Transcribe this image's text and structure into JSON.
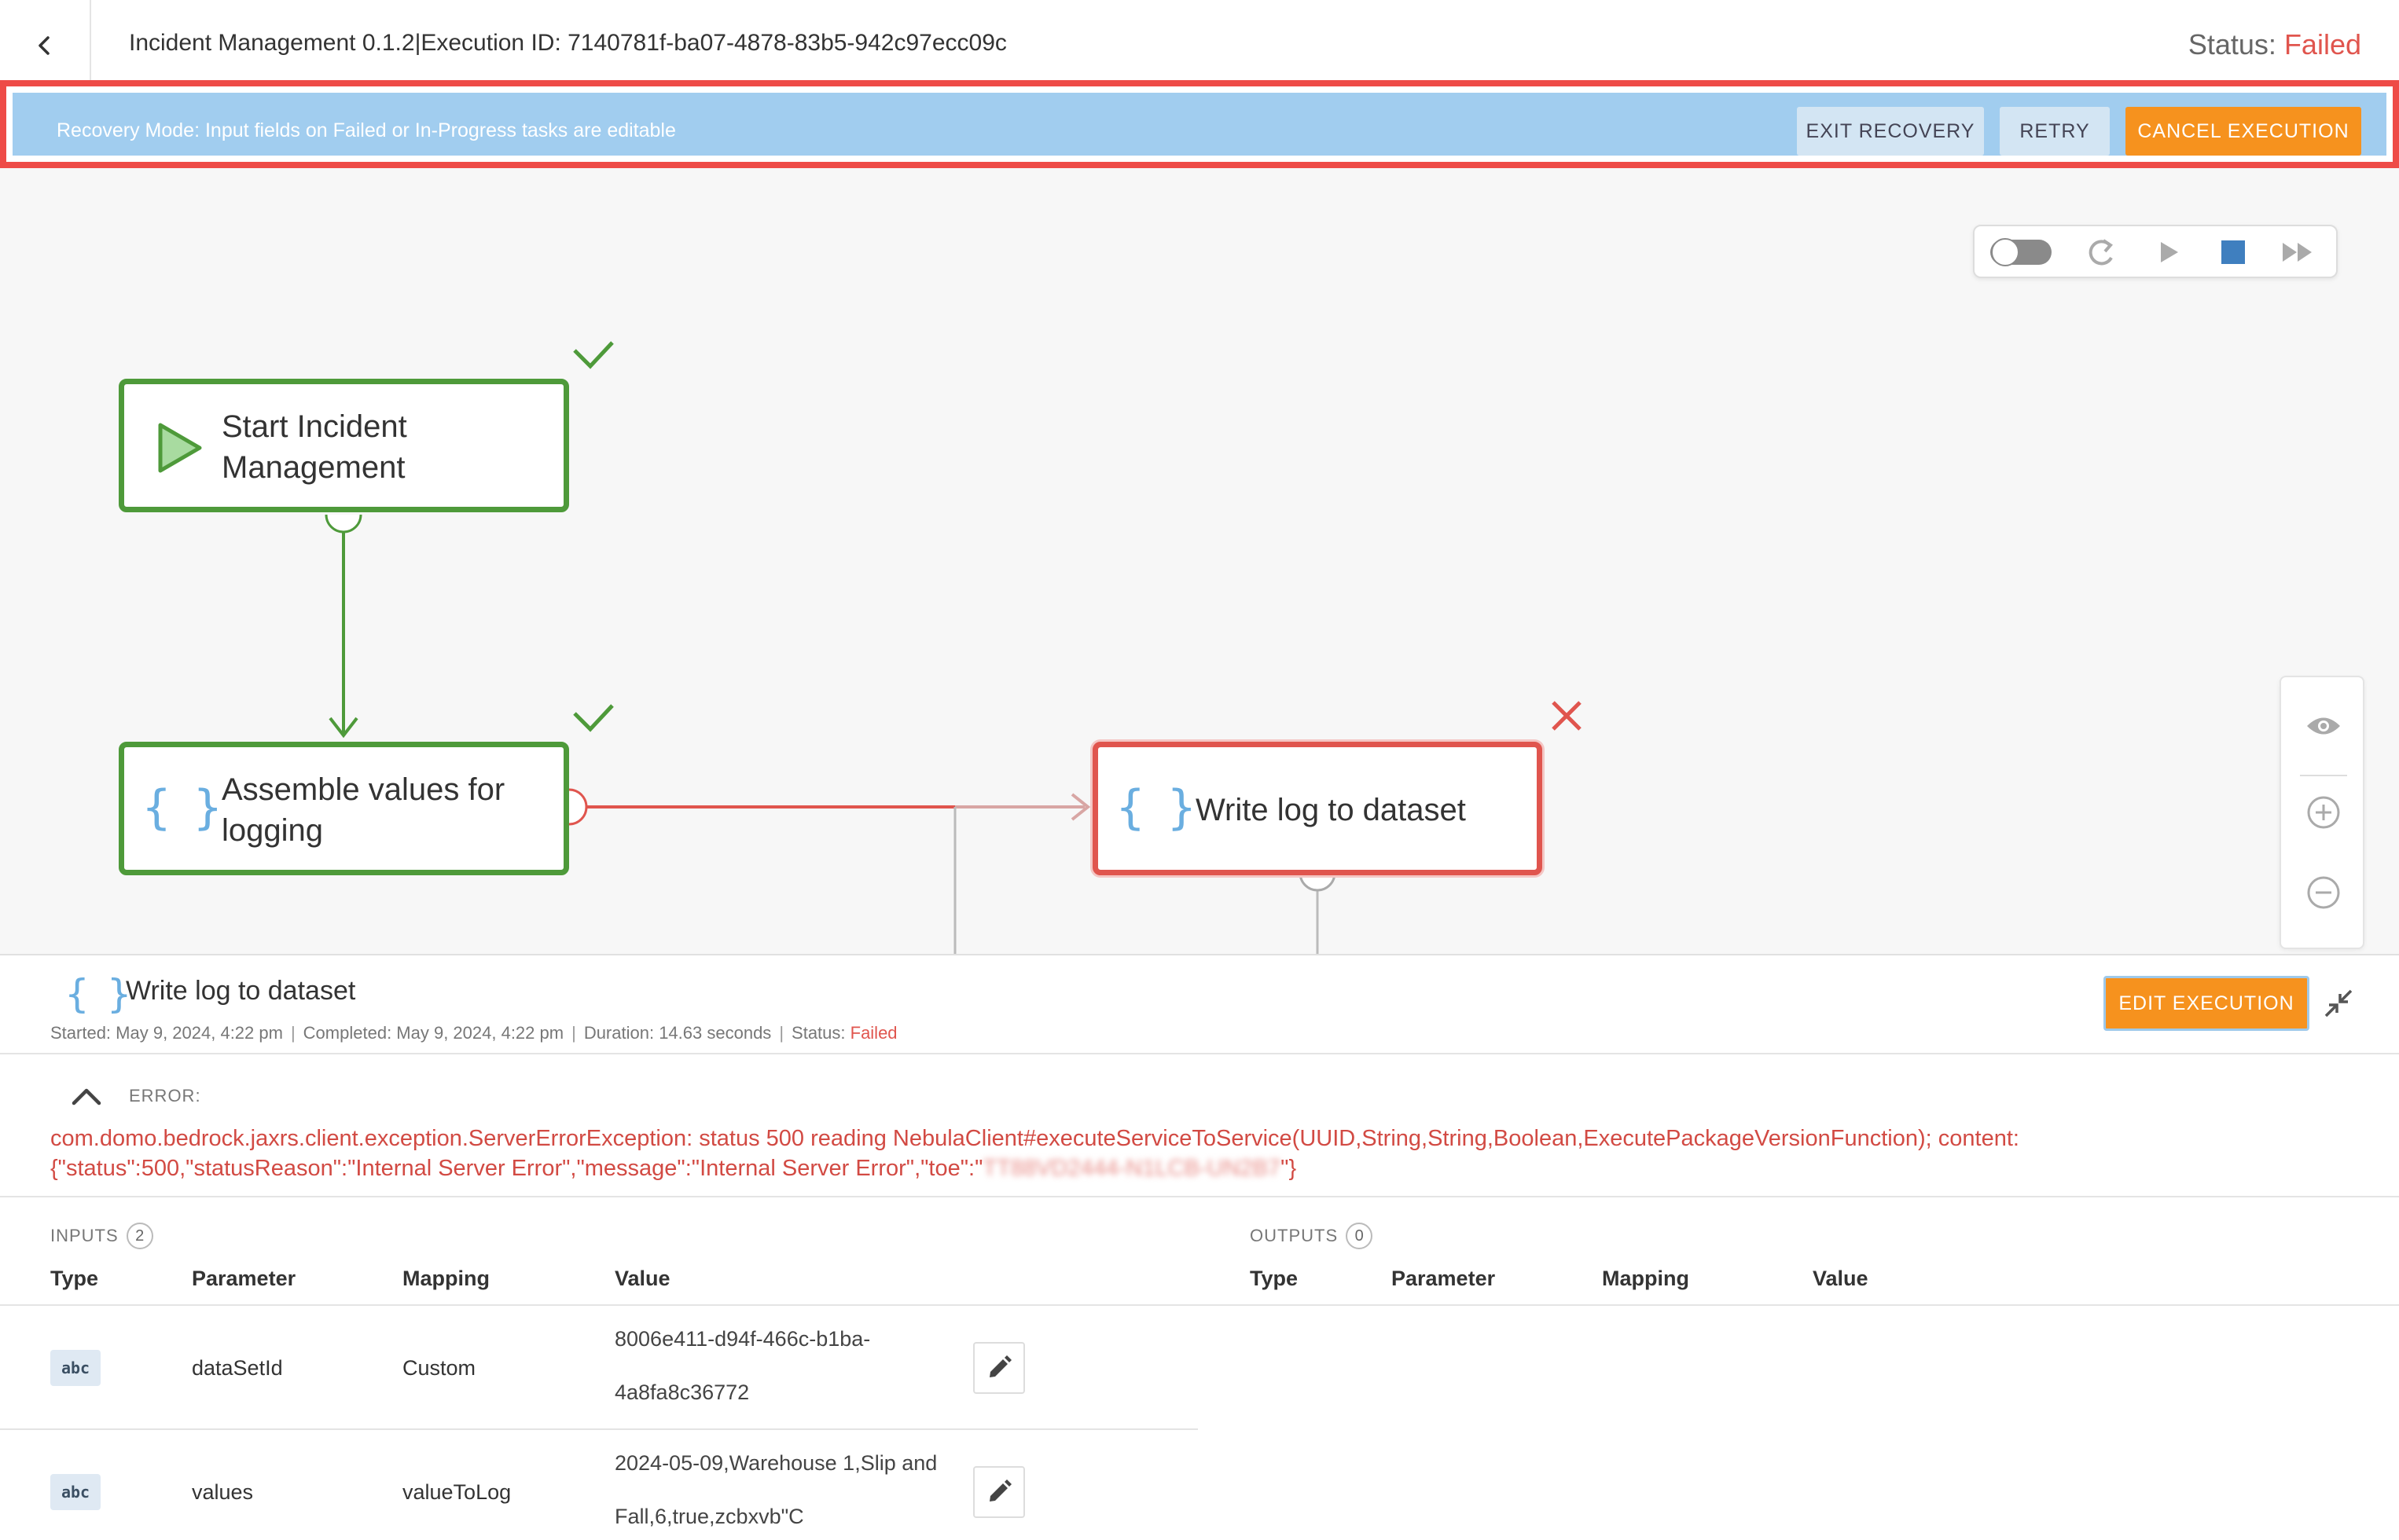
{
  "header": {
    "title": "Incident Management 0.1.2|Execution ID: 7140781f-ba07-4878-83b5-942c97ecc09c",
    "status_label": "Status: ",
    "status_value": "Failed",
    "status_color": "#e0554e",
    "back_icon": "chevron-left-icon"
  },
  "banner": {
    "text": "Recovery Mode: Input fields on Failed or In-Progress tasks are editable",
    "exit_label": "EXIT RECOVERY",
    "retry_label": "RETRY",
    "cancel_label": "CANCEL EXECUTION",
    "background": "#a1cdef",
    "accent": "#f6921e"
  },
  "controls": {
    "icons": [
      "toggle-icon",
      "refresh-icon",
      "play-icon",
      "stop-icon",
      "fast-forward-icon"
    ]
  },
  "zoom": {
    "icons": [
      "eye-icon",
      "zoom-in-icon",
      "zoom-out-icon"
    ]
  },
  "flow": {
    "nodes": [
      {
        "label": "Start Incident Management",
        "status": "success",
        "icon": "play-icon"
      },
      {
        "label": "Assemble values for logging",
        "status": "success",
        "icon": "braces-icon"
      },
      {
        "label": "Write log to dataset",
        "status": "failed",
        "icon": "braces-icon"
      }
    ],
    "success_color": "#4e9a3a",
    "failed_color": "#e0554e"
  },
  "details": {
    "title": "Write log to dataset",
    "meta": {
      "started": "Started: May 9, 2024, 4:22 pm",
      "completed": "Completed: May 9, 2024, 4:22 pm",
      "duration": "Duration: 14.63 seconds",
      "status_label": "Status: ",
      "status_value": "Failed"
    },
    "edit_label": "EDIT EXECUTION",
    "error_label": "ERROR:",
    "error_line1": "com.domo.bedrock.jaxrs.client.exception.ServerErrorException: status 500 reading NebulaClient#executeServiceToService(UUID,String,String,Boolean,ExecutePackageVersionFunction); content:",
    "error_line2": "{\"status\":500,\"statusReason\":\"Internal Server Error\",\"message\":\"Internal Server Error\",\"toe\":\"",
    "error_redacted": "TT88VD2444-N1LCB-UN2B7",
    "error_line2_end": "\"}",
    "inputs_label": "INPUTS",
    "inputs_count": "2",
    "outputs_label": "OUTPUTS",
    "outputs_count": "0",
    "columns": [
      "Type",
      "Parameter",
      "Mapping",
      "Value"
    ],
    "inputs": [
      {
        "type": "abc",
        "parameter": "dataSetId",
        "mapping": "Custom",
        "value_line1": "8006e411-d94f-466c-b1ba-",
        "value_line2": "4a8fa8c36772"
      },
      {
        "type": "abc",
        "parameter": "values",
        "mapping": "valueToLog",
        "value_line1": "2024-05-09,Warehouse 1,Slip and",
        "value_line2": "Fall,6,true,zcbxvb\"C"
      }
    ]
  }
}
